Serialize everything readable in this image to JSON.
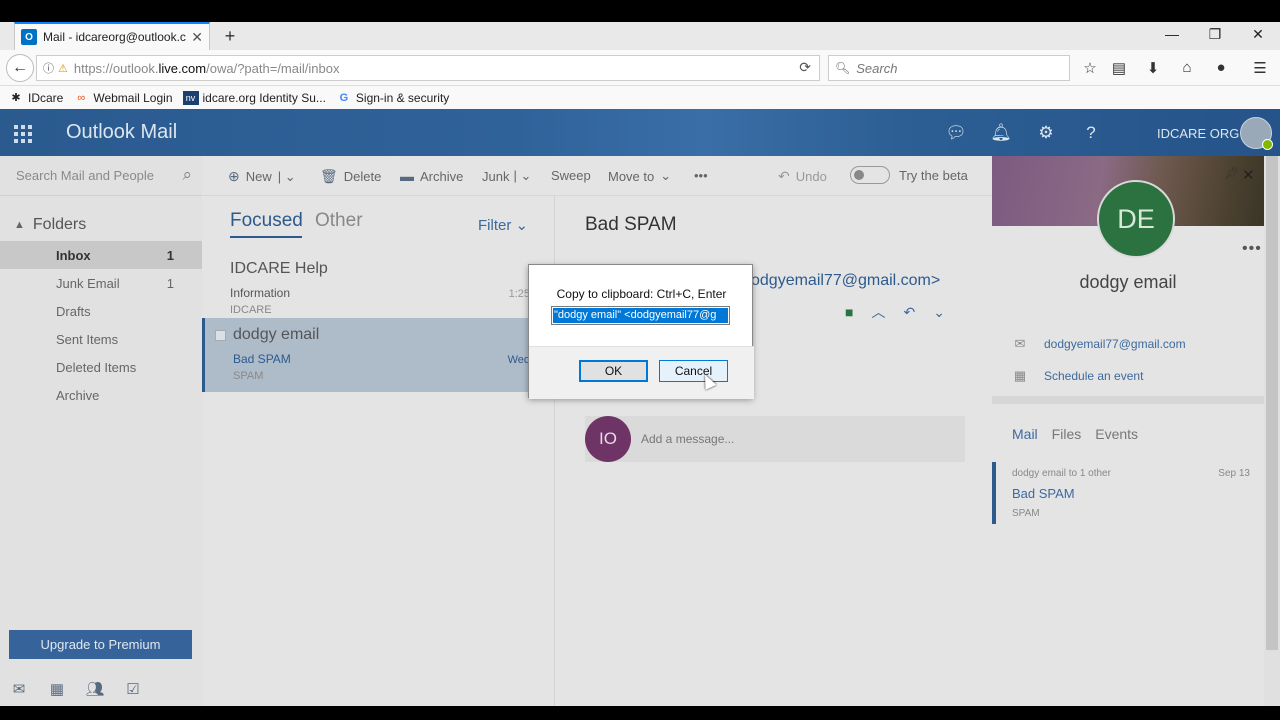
{
  "browser": {
    "tab_title": "Mail - idcareorg@outlook.c",
    "favicon_text": "O",
    "url_prefix": "https://outlook.",
    "url_domain": "live.com",
    "url_path": "/owa/?path=/mail/inbox",
    "search_placeholder": "Search",
    "bookmarks": [
      "IDcare",
      "Webmail Login",
      "idcare.org Identity Su...",
      "Sign-in & security"
    ]
  },
  "header": {
    "app_title": "Outlook Mail",
    "user_name": "IDCARE ORG"
  },
  "sidebar": {
    "search_placeholder": "Search Mail and People",
    "folders_label": "Folders",
    "folders": [
      {
        "label": "Inbox",
        "count": "1"
      },
      {
        "label": "Junk Email",
        "count": "1"
      },
      {
        "label": "Drafts",
        "count": ""
      },
      {
        "label": "Sent Items",
        "count": ""
      },
      {
        "label": "Deleted Items",
        "count": ""
      },
      {
        "label": "Archive",
        "count": ""
      }
    ],
    "premium_label": "Upgrade to Premium"
  },
  "toolbar": {
    "new_label": "New",
    "delete_label": "Delete",
    "archive_label": "Archive",
    "junk_label": "Junk",
    "sweep_label": "Sweep",
    "moveto_label": "Move to",
    "more_label": "•••",
    "undo_label": "Undo",
    "beta_label": "Try the beta"
  },
  "list": {
    "focused_label": "Focused",
    "other_label": "Other",
    "filter_label": "Filter",
    "messages": [
      {
        "from": "IDCARE Help",
        "subject": "Information",
        "preview": "IDCARE",
        "time": "1:25"
      },
      {
        "from": "dodgy email",
        "subject": "Bad SPAM",
        "preview": "SPAM",
        "time": "Wed"
      }
    ]
  },
  "reading": {
    "subject": "Bad SPAM",
    "sender_address": "odgyemail77@gmail.com>",
    "reply_initials": "IO",
    "reply_placeholder": "Add a message..."
  },
  "contact": {
    "initials": "DE",
    "name": "dodgy email",
    "email": "dodgyemail77@gmail.com",
    "schedule_label": "Schedule an event",
    "tabs": [
      "Mail",
      "Files",
      "Events"
    ],
    "item_from": "dodgy email to 1 other",
    "item_date": "Sep 13",
    "item_subject": "Bad SPAM",
    "item_preview": "SPAM"
  },
  "dialog": {
    "message": "Copy to clipboard: Ctrl+C, Enter",
    "value": "\"dodgy email\" <dodgyemail77@g",
    "ok_label": "OK",
    "cancel_label": "Cancel"
  },
  "colors": {
    "accent": "#2d5a8c",
    "selection": "#0078d7",
    "avatar_de": "#2c7240",
    "avatar_io": "#6e3465"
  }
}
